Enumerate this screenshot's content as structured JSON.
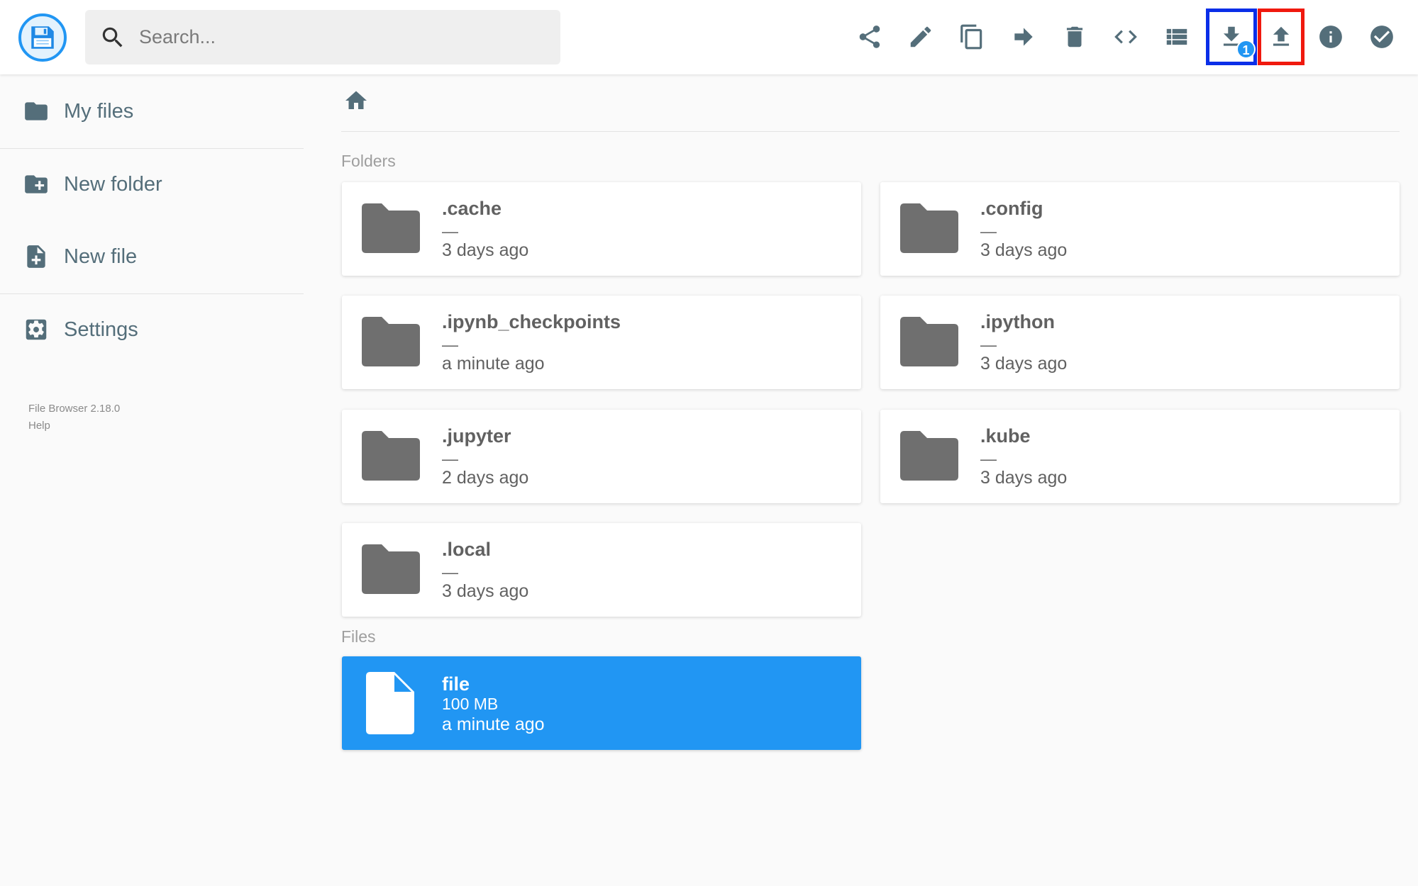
{
  "app": {
    "logo_icon": "floppy-disk-icon"
  },
  "search": {
    "placeholder": "Search..."
  },
  "toolbar": {
    "actions": [
      {
        "name": "share",
        "icon": "share-icon"
      },
      {
        "name": "rename",
        "icon": "pencil-icon"
      },
      {
        "name": "copy",
        "icon": "copy-icon"
      },
      {
        "name": "move",
        "icon": "arrow-right-icon"
      },
      {
        "name": "delete",
        "icon": "trash-icon"
      },
      {
        "name": "embed",
        "icon": "code-icon"
      },
      {
        "name": "view-mode",
        "icon": "list-icon"
      },
      {
        "name": "download",
        "icon": "download-icon",
        "badge": "1"
      },
      {
        "name": "upload",
        "icon": "upload-icon"
      },
      {
        "name": "info",
        "icon": "info-icon"
      },
      {
        "name": "select",
        "icon": "check-circle-icon"
      }
    ],
    "highlight_colors": {
      "download": "#0a2ee8",
      "upload": "#f0190e"
    }
  },
  "sidebar": {
    "items": [
      {
        "label": "My files",
        "icon": "folder-icon"
      },
      {
        "label": "New folder",
        "icon": "create-folder-icon"
      },
      {
        "label": "New file",
        "icon": "note-add-icon"
      },
      {
        "label": "Settings",
        "icon": "settings-icon"
      }
    ],
    "version": "File Browser 2.18.0",
    "help": "Help"
  },
  "breadcrumb": {
    "home_icon": "home-icon"
  },
  "folders": {
    "title": "Folders",
    "items": [
      {
        "name": ".cache",
        "size": "—",
        "modified": "3 days ago"
      },
      {
        "name": ".config",
        "size": "—",
        "modified": "3 days ago"
      },
      {
        "name": ".ipynb_checkpoints",
        "size": "—",
        "modified": "a minute ago"
      },
      {
        "name": ".ipython",
        "size": "—",
        "modified": "3 days ago"
      },
      {
        "name": ".jupyter",
        "size": "—",
        "modified": "2 days ago"
      },
      {
        "name": ".kube",
        "size": "—",
        "modified": "3 days ago"
      },
      {
        "name": ".local",
        "size": "—",
        "modified": "3 days ago"
      }
    ]
  },
  "files": {
    "title": "Files",
    "items": [
      {
        "name": "file",
        "size": "100 MB",
        "modified": "a minute ago",
        "selected": true
      }
    ]
  },
  "colors": {
    "accent": "#2196f3",
    "icon": "#546e7a",
    "folder": "#6f6f6f"
  }
}
